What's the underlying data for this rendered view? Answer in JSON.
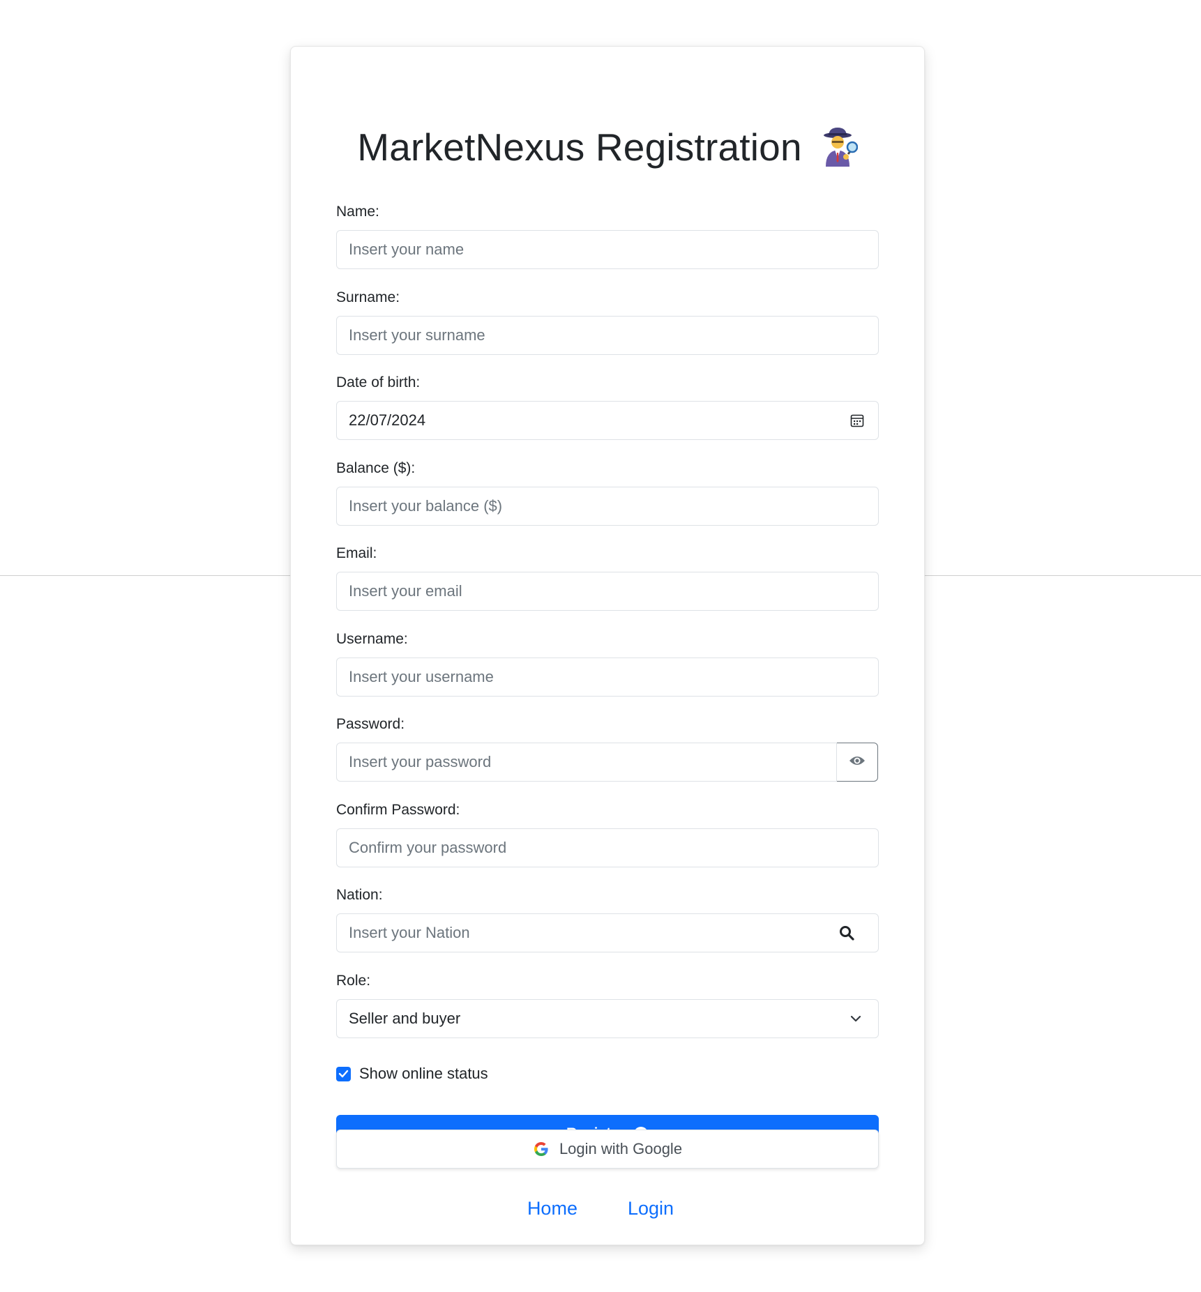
{
  "page": {
    "title": "MarketNexus Registration",
    "title_icon": "spy-emoji"
  },
  "form": {
    "name": {
      "label": "Name:",
      "placeholder": "Insert your name"
    },
    "surname": {
      "label": "Surname:",
      "placeholder": "Insert your surname"
    },
    "dob": {
      "label": "Date of birth:",
      "value": "22/07/2024",
      "icon": "calendar-icon"
    },
    "balance": {
      "label": "Balance ($):",
      "placeholder": "Insert your balance ($)"
    },
    "email": {
      "label": "Email:",
      "placeholder": "Insert your email"
    },
    "username": {
      "label": "Username:",
      "placeholder": "Insert your username"
    },
    "password": {
      "label": "Password:",
      "placeholder": "Insert your password",
      "toggle_icon": "eye-icon"
    },
    "confirm_password": {
      "label": "Confirm Password:",
      "placeholder": "Confirm your password"
    },
    "nation": {
      "label": "Nation:",
      "placeholder": "Insert your Nation",
      "icon": "search-icon"
    },
    "role": {
      "label": "Role:",
      "selected": "Seller and buyer",
      "icon": "chevron-down-icon"
    },
    "online_status": {
      "label": "Show online status",
      "checked": true
    }
  },
  "actions": {
    "register_label": "Register",
    "register_icon": "registered-icon",
    "google_label": "Login with Google",
    "google_icon": "google-icon"
  },
  "footer_links": {
    "home": "Home",
    "login": "Login"
  },
  "colors": {
    "primary": "#0d6efd",
    "border": "#dee2e6",
    "placeholder": "#6c757d",
    "text": "#212529"
  }
}
